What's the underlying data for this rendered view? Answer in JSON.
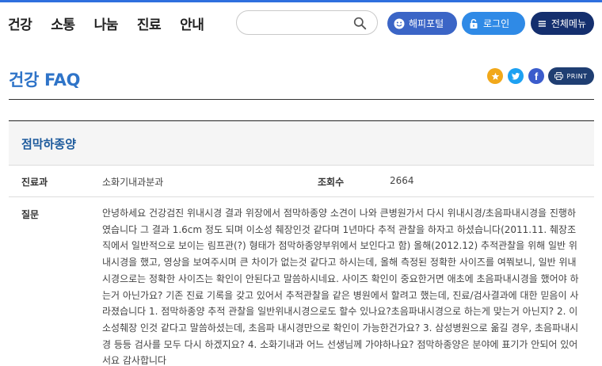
{
  "nav": {
    "items": [
      "건강",
      "소통",
      "나눔",
      "진료",
      "안내"
    ]
  },
  "search": {
    "placeholder": ""
  },
  "header_buttons": {
    "happy_portal": "해피포털",
    "login": "로그인",
    "all_menu": "전체메뉴"
  },
  "page": {
    "title": "건강 FAQ",
    "print_label": "PRINT"
  },
  "share_icons": [
    "star-icon",
    "twitter-icon",
    "facebook-icon"
  ],
  "faq": {
    "title": "점막하종양",
    "dept_label": "진료과",
    "dept_value": "소화기내과분과",
    "views_label": "조회수",
    "views_value": "2664",
    "question_label": "질문",
    "question_text": "안녕하세요 건강검진 위내시경 결과 위장에서 점막하종양 소견이 나와 큰병원가서 다시 위내시경/초음파내시경을 진행하였습니다 그 결과 1.6cm 정도 되며 이소성 췌장인것 같다며 1년마다 추적 관찰을 하자고 하셨습니다(2011.11. 췌장조직에서 일반적으로 보이는 림프관(?) 형태가 점막하종양부위에서 보인다고 함) 올해(2012.12) 추적관찰을 위해 일반 위내시경을 했고, 영상을 보여주시며 큰 차이가 없는것 같다고 하시는데, 올해 측정된 정확한 사이즈를 여쭤보니, 일반 위내시경으로는 정확한 사이즈는 확인이 안된다고 말씀하시네요. 사이즈 확인이 중요한거면 애초에 초음파내시경을 했어야 하는거 아닌가요? 기존 진료 기록을 갖고 있어서 추적관찰을 같은 병원에서 할려고 했는데, 진료/검사결과에 대한 믿음이 사라졌습니다 1. 점막하종양 추적 관찰을 일반위내시경으로도 할수 있나요?초음파내시경으로 하는게 맞는거 아닌지? 2. 이소성췌장 인것 같다고 말씀하셨는데, 초음파 내시경만으로 확인이 가능한건가요? 3. 삼성병원으로 옮길 경우, 초음파내시경 등등 검사를 모두 다시 하겠지요? 4. 소화기내과 어느 선생님께 가야하나요? 점막하종양은 분야에 표기가 안되어 있어서요 감사합니다"
  },
  "colors": {
    "accent_blue": "#2f74c8",
    "happy_portal_bg": "#3b65c6",
    "login_bg": "#2f8ae6",
    "menu_bg": "#142f6e",
    "print_bg": "#1f3e72"
  }
}
